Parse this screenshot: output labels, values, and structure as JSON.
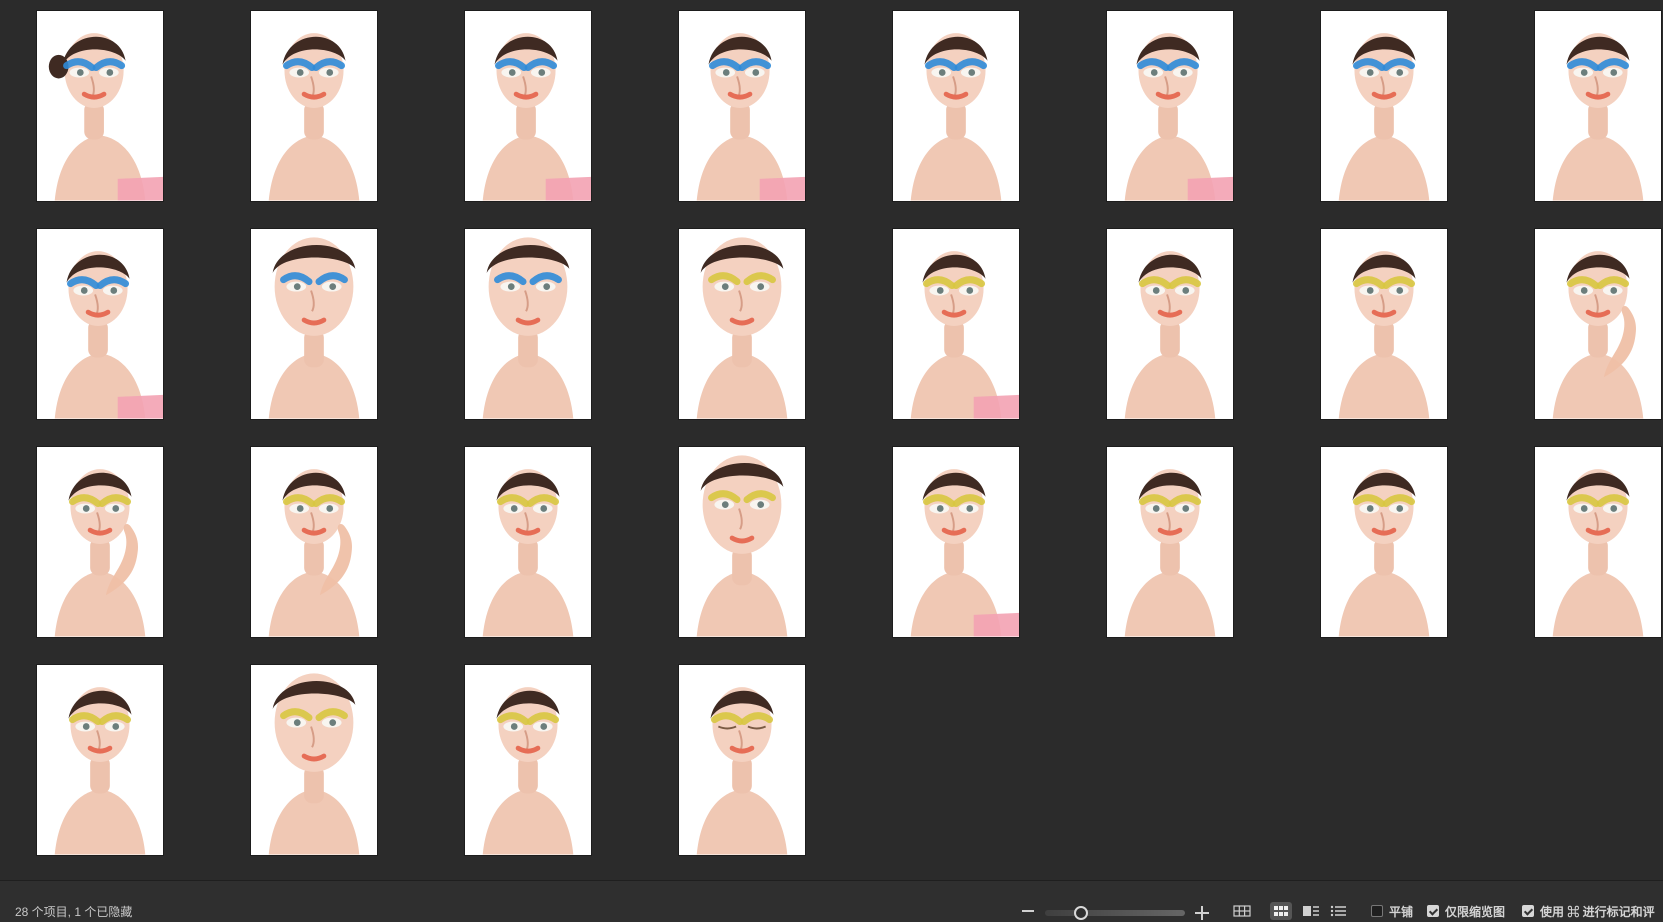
{
  "photo_grid": {
    "photos": [
      {
        "makeup": "blue",
        "pose": "profile"
      },
      {
        "makeup": "blue",
        "pose": "front"
      },
      {
        "makeup": "blue",
        "pose": "turned"
      },
      {
        "makeup": "blue",
        "pose": "turned"
      },
      {
        "makeup": "blue",
        "pose": "front"
      },
      {
        "makeup": "blue",
        "pose": "turned"
      },
      {
        "makeup": "blue",
        "pose": "front"
      },
      {
        "makeup": "blue",
        "pose": "front"
      },
      {
        "makeup": "blue",
        "pose": "turned"
      },
      {
        "makeup": "blue",
        "pose": "close"
      },
      {
        "makeup": "blue",
        "pose": "close"
      },
      {
        "makeup": "yellow",
        "pose": "close"
      },
      {
        "makeup": "yellow",
        "pose": "turned"
      },
      {
        "makeup": "yellow",
        "pose": "front"
      },
      {
        "makeup": "yellow",
        "pose": "front"
      },
      {
        "makeup": "yellow",
        "pose": "hand"
      },
      {
        "makeup": "yellow",
        "pose": "hand"
      },
      {
        "makeup": "yellow",
        "pose": "hand"
      },
      {
        "makeup": "yellow",
        "pose": "front"
      },
      {
        "makeup": "yellow",
        "pose": "close"
      },
      {
        "makeup": "yellow",
        "pose": "turned"
      },
      {
        "makeup": "yellow",
        "pose": "front"
      },
      {
        "makeup": "yellow",
        "pose": "front"
      },
      {
        "makeup": "yellow",
        "pose": "front"
      },
      {
        "makeup": "yellow",
        "pose": "front"
      },
      {
        "makeup": "yellow",
        "pose": "close"
      },
      {
        "makeup": "yellow",
        "pose": "front"
      },
      {
        "makeup": "yellow",
        "pose": "closed-eyes"
      }
    ]
  },
  "status_bar": {
    "item_count": "28 个项目, 1 个已隐藏",
    "tile_label": "平铺",
    "thumbnail_only_label": "仅限缩览图",
    "use_cmd_label": "使用 ⌘ 进行标记和评",
    "tile_checked": false,
    "thumbnail_only_checked": true,
    "use_cmd_checked": true
  },
  "colors": {
    "background": "#2b2b2b",
    "statusbar": "#2f2f2f",
    "text": "#d3d3d3",
    "blue_makeup": "#2f8bd8",
    "yellow_makeup": "#d8c640"
  },
  "icons": {
    "zoom_out": "minus-icon",
    "zoom_in": "plus-icon",
    "grid_large": "grid-large-icon",
    "grid_small": "grid-small-icon",
    "list_view": "list-view-icon",
    "details_view": "details-view-icon",
    "checkbox": "checkbox-icon"
  }
}
